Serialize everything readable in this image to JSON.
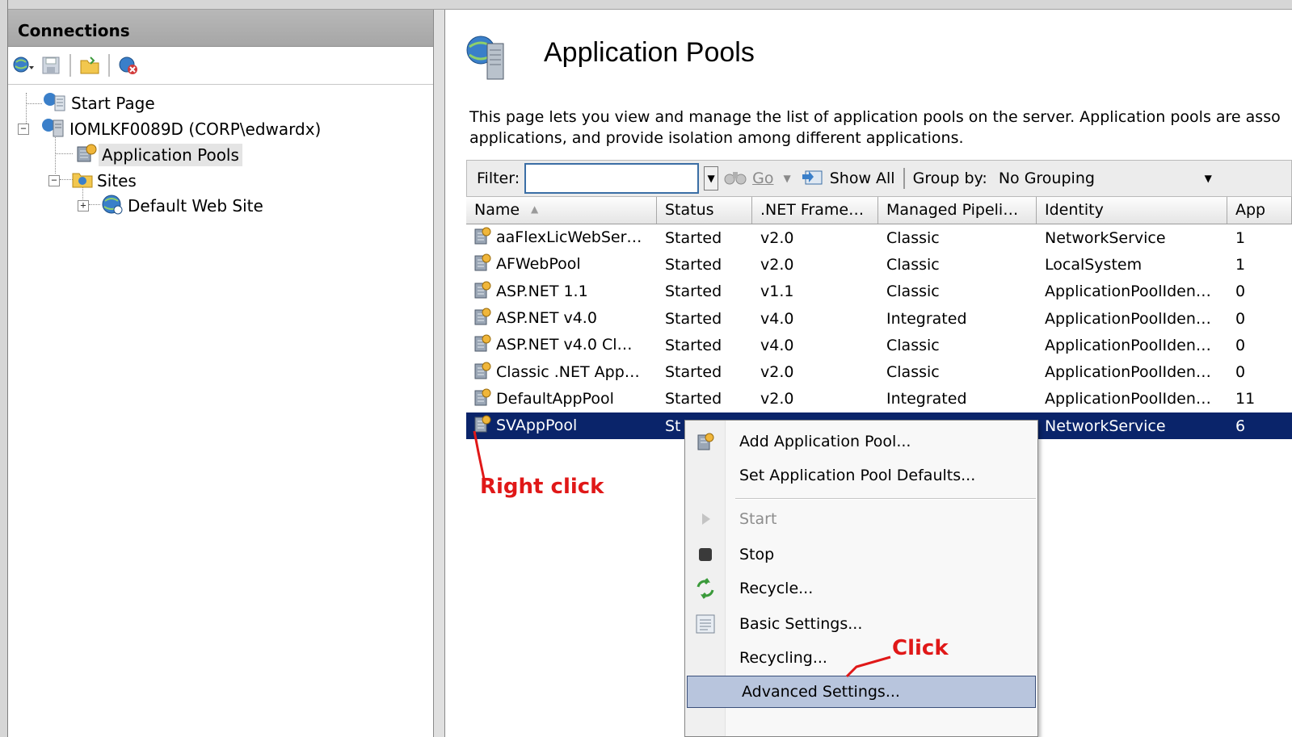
{
  "connections": {
    "header": "Connections",
    "tree": {
      "start_page": "Start Page",
      "server": "IOMLKF0089D (CORP\\edwardx)",
      "app_pools": "Application Pools",
      "sites": "Sites",
      "default_site": "Default Web Site"
    }
  },
  "main": {
    "title": "Application Pools",
    "description_line1": "This page lets you view and manage the list of application pools on the server. Application pools are asso",
    "description_line2": "applications, and provide isolation among different applications."
  },
  "filterbar": {
    "filter_label": "Filter:",
    "go_label": "Go",
    "show_all_label": "Show All",
    "group_by_label": "Group by:",
    "group_by_value": "No Grouping"
  },
  "grid": {
    "columns": [
      "Name",
      "Status",
      ".NET Frame…",
      "Managed Pipeli…",
      "Identity",
      "App"
    ],
    "rows": [
      [
        "aaFlexLicWebSer…",
        "Started",
        "v2.0",
        "Classic",
        "NetworkService",
        "1"
      ],
      [
        "AFWebPool",
        "Started",
        "v2.0",
        "Classic",
        "LocalSystem",
        "1"
      ],
      [
        "ASP.NET 1.1",
        "Started",
        "v1.1",
        "Classic",
        "ApplicationPoolIden…",
        "0"
      ],
      [
        "ASP.NET v4.0",
        "Started",
        "v4.0",
        "Integrated",
        "ApplicationPoolIden…",
        "0"
      ],
      [
        "ASP.NET v4.0 Cl…",
        "Started",
        "v4.0",
        "Classic",
        "ApplicationPoolIden…",
        "0"
      ],
      [
        "Classic .NET App…",
        "Started",
        "v2.0",
        "Classic",
        "ApplicationPoolIden…",
        "0"
      ],
      [
        "DefaultAppPool",
        "Started",
        "v2.0",
        "Integrated",
        "ApplicationPoolIden…",
        "11"
      ],
      [
        "SVAppPool",
        "St",
        "",
        "",
        "NetworkService",
        "6"
      ]
    ],
    "selected_index": 7
  },
  "context_menu": {
    "items": [
      {
        "label": "Add Application Pool...",
        "icon": "add-pool-icon"
      },
      {
        "label": "Set Application Pool Defaults...",
        "icon": ""
      },
      {
        "label": "Start",
        "icon": "start-icon",
        "disabled": true
      },
      {
        "label": "Stop",
        "icon": "stop-icon"
      },
      {
        "label": "Recycle...",
        "icon": "recycle-icon"
      },
      {
        "label": "Basic Settings...",
        "icon": "settings-icon"
      },
      {
        "label": "Recycling...",
        "icon": ""
      },
      {
        "label": "Advanced Settings...",
        "icon": "",
        "highlighted": true
      }
    ]
  },
  "annotations": {
    "right_click": "Right click",
    "click": "Click",
    "color": "#e01818"
  },
  "colors": {
    "selection": "#0a246a",
    "menu_highlight": "#b8c5dd"
  }
}
